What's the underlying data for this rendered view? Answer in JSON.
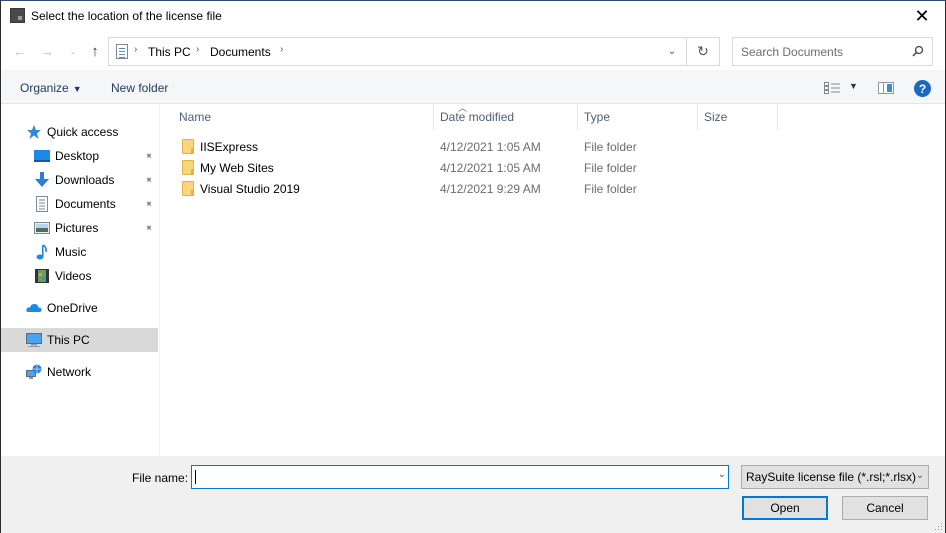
{
  "window": {
    "title": "Select the location of the license file",
    "close_glyph": "✕"
  },
  "nav": {
    "back_glyph": "←",
    "forward_glyph": "→",
    "recent_glyph": "⌄",
    "up_glyph": "↑",
    "breadcrumb": [
      {
        "label": "This PC"
      },
      {
        "label": "Documents"
      }
    ],
    "crumb_sep": "›",
    "address_dropdown_glyph": "⌄",
    "refresh_glyph": "↻",
    "search_placeholder": "Search Documents"
  },
  "toolbar": {
    "organize_label": "Organize",
    "organize_caret": "▼",
    "new_folder_label": "New folder",
    "view_caret": "▼",
    "help_glyph": "?"
  },
  "sidebar": {
    "items": [
      {
        "label": "Quick access",
        "icon": "star-icon"
      },
      {
        "label": "Desktop",
        "icon": "desktop-icon",
        "pinned": true
      },
      {
        "label": "Downloads",
        "icon": "download-icon",
        "pinned": true
      },
      {
        "label": "Documents",
        "icon": "document-icon",
        "pinned": true
      },
      {
        "label": "Pictures",
        "icon": "pictures-icon",
        "pinned": true
      },
      {
        "label": "Music",
        "icon": "music-icon"
      },
      {
        "label": "Videos",
        "icon": "videos-icon"
      },
      {
        "label": "OneDrive",
        "icon": "cloud-icon"
      },
      {
        "label": "This PC",
        "icon": "computer-icon",
        "selected": true
      },
      {
        "label": "Network",
        "icon": "network-icon"
      }
    ],
    "pin_glyph": "📌"
  },
  "columns": {
    "name": "Name",
    "date": "Date modified",
    "type": "Type",
    "size": "Size",
    "sort_glyph": "^"
  },
  "files": [
    {
      "name": "IISExpress",
      "date": "4/12/2021 1:05 AM",
      "type": "File folder",
      "size": ""
    },
    {
      "name": "My Web Sites",
      "date": "4/12/2021 1:05 AM",
      "type": "File folder",
      "size": ""
    },
    {
      "name": "Visual Studio 2019",
      "date": "4/12/2021 9:29 AM",
      "type": "File folder",
      "size": ""
    }
  ],
  "bottom": {
    "file_name_label": "File name:",
    "file_name_value": "",
    "file_name_dropdown_glyph": "⌄",
    "filter_selected": "RaySuite license file (*.rsl;*.rlsx)",
    "filter_caret": "⌄",
    "open_label": "Open",
    "cancel_label": "Cancel"
  },
  "colors": {
    "accent": "#0078d7",
    "selected_bg": "#d9d9d9",
    "command_text": "#1e395b",
    "folder": "#f8d77a"
  }
}
